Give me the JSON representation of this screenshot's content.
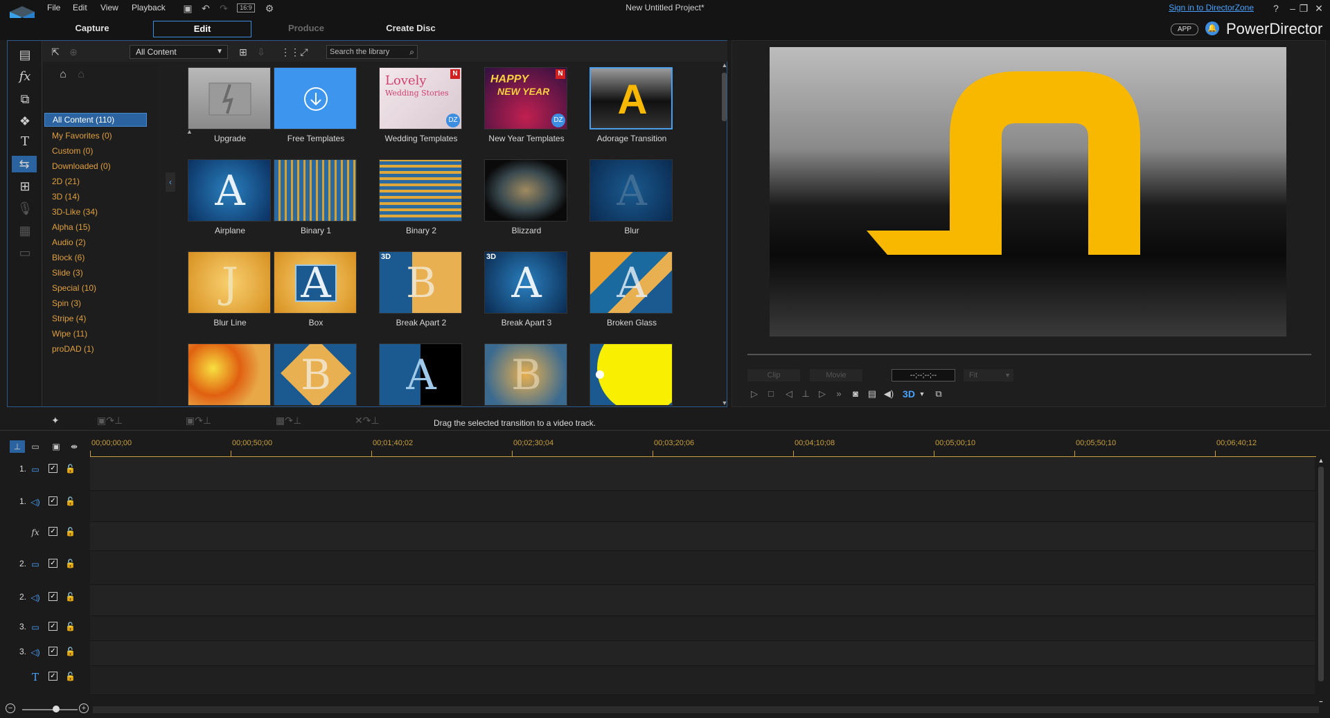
{
  "titlebar": {
    "menu": [
      "File",
      "Edit",
      "View",
      "Playback"
    ],
    "aspect_ratio": "16:9",
    "project_title": "New Untitled Project*",
    "signin_link": "Sign in to DirectorZone",
    "help": "?",
    "minimize": "–",
    "restore": "❐",
    "close": "✕"
  },
  "modes": {
    "capture": "Capture",
    "edit": "Edit",
    "produce": "Produce",
    "create_disc": "Create Disc"
  },
  "brand": {
    "app_badge": "APP",
    "name": "PowerDirector"
  },
  "library": {
    "content_filter": "All Content",
    "search_placeholder": "Search the library"
  },
  "categories": [
    "All Content (110)",
    "My Favorites  (0)",
    "Custom  (0)",
    "Downloaded  (0)",
    "2D  (21)",
    "3D  (14)",
    "3D-Like  (34)",
    "Alpha  (15)",
    "Audio  (2)",
    "Block  (6)",
    "Slide  (3)",
    "Special  (10)",
    "Spin  (3)",
    "Stripe  (4)",
    "Wipe  (11)",
    "proDAD  (1)"
  ],
  "thumbnails": {
    "row1": [
      "Upgrade",
      "Free Templates",
      "Wedding Templates",
      "New Year Templates",
      "Adorage Transition"
    ],
    "row2": [
      "Airplane",
      "Binary 1",
      "Binary 2",
      "Blizzard",
      "Blur"
    ],
    "row3": [
      "Blur Line",
      "Box",
      "Break Apart 2",
      "Break Apart 3",
      "Broken Glass"
    ],
    "wedding_text_1": "Lovely",
    "wedding_text_2": "Wedding Stories",
    "newyear_text_1": "HAPPY",
    "newyear_text_2": "NEW YEAR",
    "badge_new": "N",
    "badge_dz": "DZ",
    "badge_3d": "3D"
  },
  "preview": {
    "clip_label": "Clip",
    "movie_label": "Movie",
    "timecode": "--;--;--;--",
    "fit_label": "Fit",
    "btn_3d": "3D"
  },
  "hint": "Drag the selected transition to a video track.",
  "timeline": {
    "ticks": [
      "00;00;00;00",
      "00;00;50;00",
      "00;01;40;02",
      "00;02;30;04",
      "00;03;20;06",
      "00;04;10;08",
      "00;05;00;10",
      "00;05;50;10",
      "00;06;40;12"
    ],
    "tracks": [
      {
        "num": "1.",
        "type": "video"
      },
      {
        "num": "1.",
        "type": "audio"
      },
      {
        "num": "",
        "type": "fx"
      },
      {
        "num": "2.",
        "type": "video"
      },
      {
        "num": "2.",
        "type": "audio"
      },
      {
        "num": "3.",
        "type": "video"
      },
      {
        "num": "3.",
        "type": "audio"
      },
      {
        "num": "",
        "type": "title"
      }
    ]
  },
  "colors": {
    "accent_blue": "#3d8de0",
    "category_orange": "#e0a040",
    "ruler_gold": "#c8a040",
    "adorage_yellow": "#f8b800"
  }
}
